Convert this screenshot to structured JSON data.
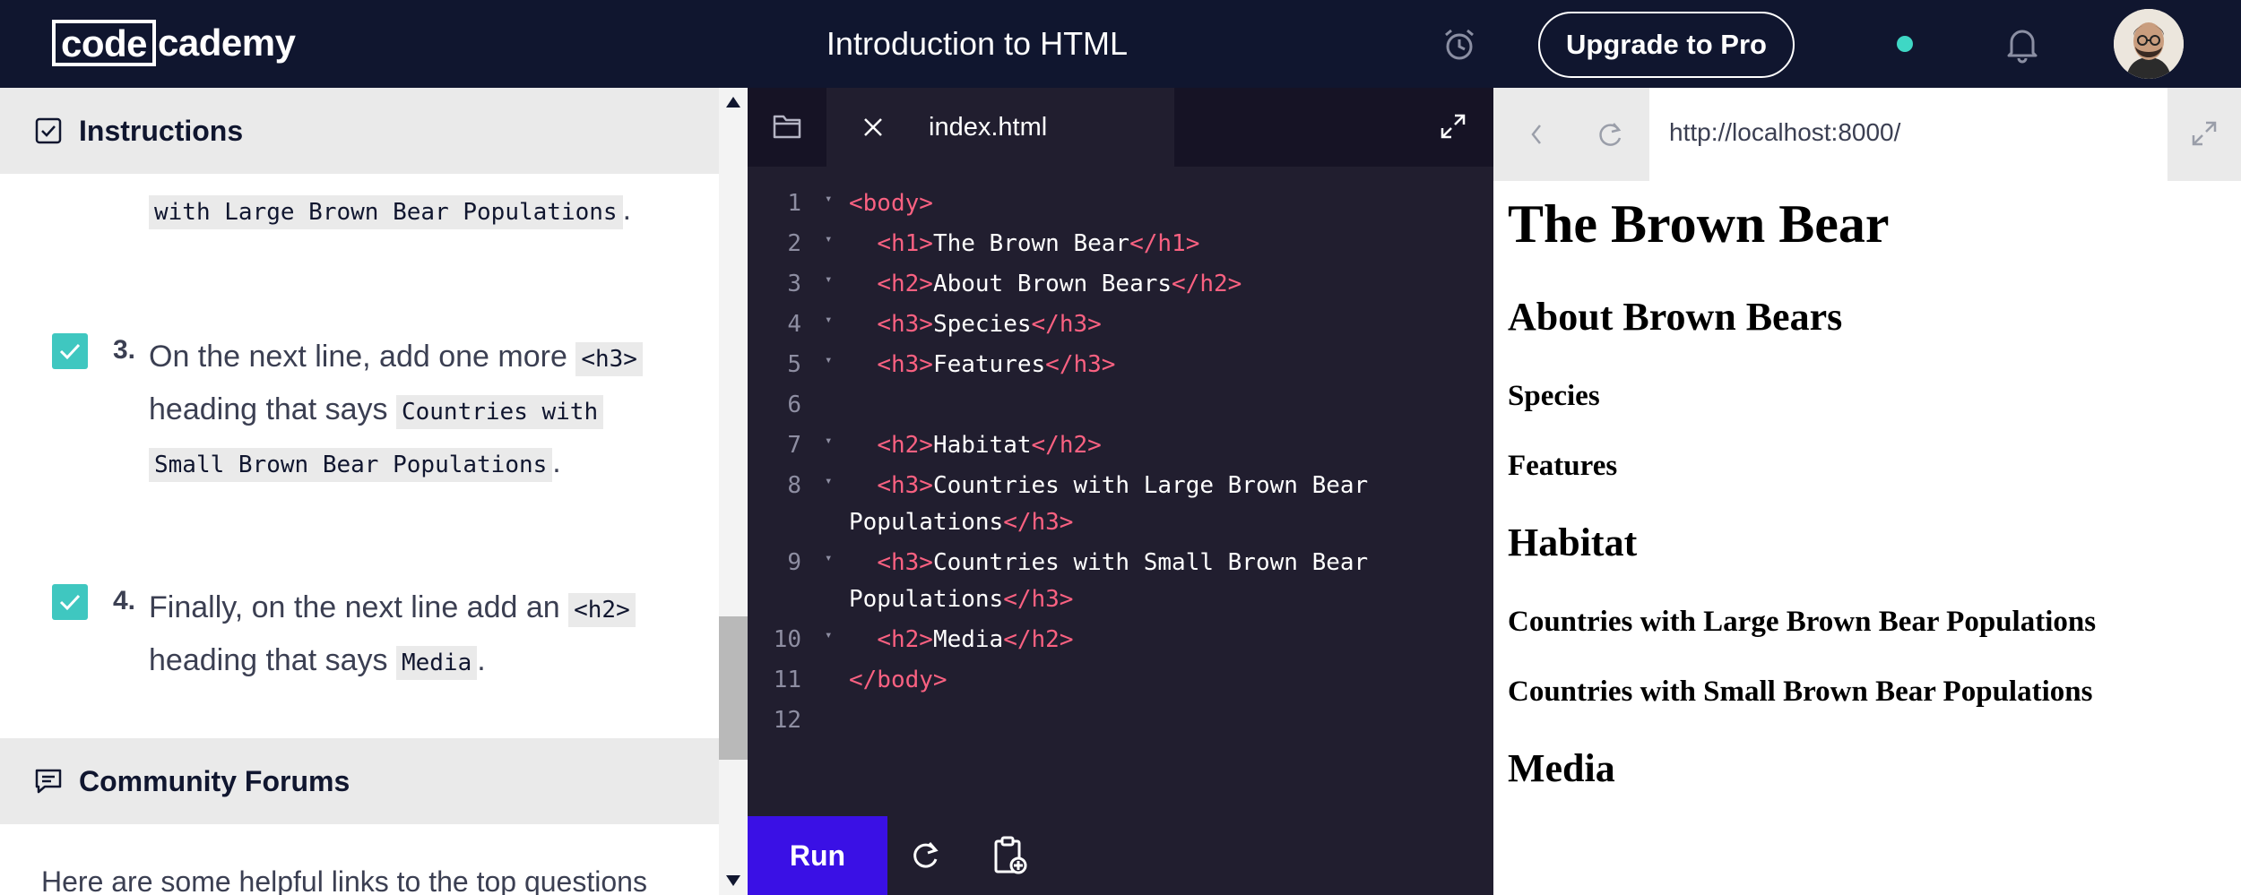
{
  "header": {
    "logo_part1": "code",
    "logo_part2": "cademy",
    "course_title": "Introduction to HTML",
    "upgrade_label": "Upgrade to Pro"
  },
  "instructions": {
    "section_title": "Instructions",
    "carryover_code": "with Large Brown Bear Populations",
    "carryover_suffix": ".",
    "steps": [
      {
        "number": "3.",
        "text_a": "On the next line, add one more ",
        "code_a": "<h3>",
        "text_b": "heading that says ",
        "code_b": "Countries with",
        "code_c": "Small Brown Bear Populations",
        "text_c": ".",
        "checked": true
      },
      {
        "number": "4.",
        "text_a": "Finally, on the next line add an ",
        "code_a": "<h2>",
        "text_b": "heading that says ",
        "code_b": "Media",
        "text_c": ".",
        "checked": true
      }
    ]
  },
  "community": {
    "section_title": "Community Forums",
    "intro_text": "Here are some helpful links to the top questions"
  },
  "editor": {
    "file_name": "index.html",
    "run_label": "Run",
    "lines": [
      {
        "num": "1",
        "fold": true,
        "parts": [
          [
            "tag",
            "<body>"
          ]
        ]
      },
      {
        "num": "2",
        "fold": true,
        "parts": [
          [
            "pad",
            "  "
          ],
          [
            "tag",
            "<h1>"
          ],
          [
            "text",
            "The Brown Bear"
          ],
          [
            "tag",
            "</h1>"
          ]
        ]
      },
      {
        "num": "3",
        "fold": true,
        "parts": [
          [
            "pad",
            "  "
          ],
          [
            "tag",
            "<h2>"
          ],
          [
            "text",
            "About Brown Bears"
          ],
          [
            "tag",
            "</h2>"
          ]
        ]
      },
      {
        "num": "4",
        "fold": true,
        "parts": [
          [
            "pad",
            "  "
          ],
          [
            "tag",
            "<h3>"
          ],
          [
            "text",
            "Species"
          ],
          [
            "tag",
            "</h3>"
          ]
        ]
      },
      {
        "num": "5",
        "fold": true,
        "parts": [
          [
            "pad",
            "  "
          ],
          [
            "tag",
            "<h3>"
          ],
          [
            "text",
            "Features"
          ],
          [
            "tag",
            "</h3>"
          ]
        ]
      },
      {
        "num": "6",
        "fold": false,
        "parts": []
      },
      {
        "num": "7",
        "fold": true,
        "parts": [
          [
            "pad",
            "  "
          ],
          [
            "tag",
            "<h2>"
          ],
          [
            "text",
            "Habitat"
          ],
          [
            "tag",
            "</h2>"
          ]
        ]
      },
      {
        "num": "8",
        "fold": true,
        "parts": [
          [
            "pad",
            "  "
          ],
          [
            "tag",
            "<h3>"
          ],
          [
            "text",
            "Countries with Large Brown Bear"
          ]
        ],
        "wrap": [
          [
            "text",
            "Populations"
          ],
          [
            "tag",
            "</h3>"
          ]
        ]
      },
      {
        "num": "9",
        "fold": true,
        "parts": [
          [
            "pad",
            "  "
          ],
          [
            "tag",
            "<h3>"
          ],
          [
            "text",
            "Countries with Small Brown Bear"
          ]
        ],
        "wrap": [
          [
            "text",
            "Populations"
          ],
          [
            "tag",
            "</h3>"
          ]
        ]
      },
      {
        "num": "10",
        "fold": true,
        "parts": [
          [
            "pad",
            "  "
          ],
          [
            "tag",
            "<h2>"
          ],
          [
            "text",
            "Media"
          ],
          [
            "tag",
            "</h2>"
          ]
        ]
      },
      {
        "num": "11",
        "fold": false,
        "parts": [
          [
            "tag",
            "</body>"
          ]
        ]
      },
      {
        "num": "12",
        "fold": false,
        "parts": []
      }
    ]
  },
  "preview": {
    "url": "http://localhost:8000/",
    "headings": [
      {
        "level": "h1",
        "text": "The Brown Bear"
      },
      {
        "level": "h2",
        "text": "About Brown Bears"
      },
      {
        "level": "h3",
        "text": "Species"
      },
      {
        "level": "h3",
        "text": "Features"
      },
      {
        "level": "h2",
        "text": "Habitat"
      },
      {
        "level": "h3",
        "text": "Countries with Large Brown Bear Populations"
      },
      {
        "level": "h3",
        "text": "Countries with Small Brown Bear Populations"
      },
      {
        "level": "h2",
        "text": "Media"
      }
    ]
  },
  "colors": {
    "header_bg": "#10162f",
    "editor_bg": "#211e2f",
    "tag_pink": "#fa6181",
    "run_blue": "#3a10e5",
    "check_teal": "#3fc7c0",
    "status_dot": "#3fd7c5"
  },
  "icons": [
    "alarm-clock-icon",
    "bell-icon",
    "checklist-icon",
    "chat-icon",
    "folder-icon",
    "close-icon",
    "expand-icon",
    "refresh-icon",
    "clipboard-add-icon",
    "back-icon",
    "reload-icon"
  ]
}
